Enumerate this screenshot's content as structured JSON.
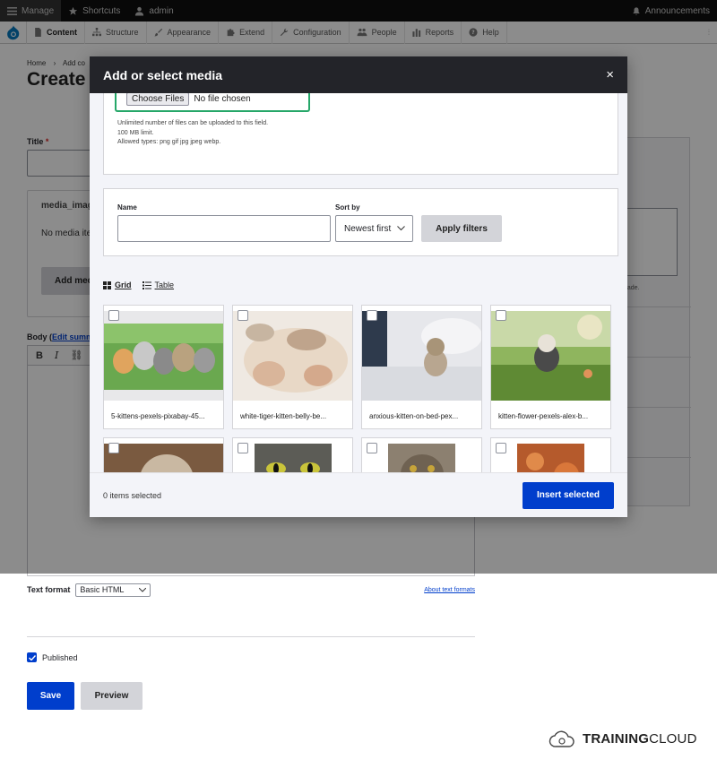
{
  "toolbar": {
    "manage": "Manage",
    "shortcuts": "Shortcuts",
    "user": "admin",
    "announcements": "Announcements"
  },
  "nav": {
    "items": [
      "Content",
      "Structure",
      "Appearance",
      "Extend",
      "Configuration",
      "People",
      "Reports",
      "Help"
    ]
  },
  "page": {
    "breadcrumb_home": "Home",
    "breadcrumb_sep": "›",
    "breadcrumb_next": "Add co",
    "title": "Create",
    "title_label": "Title",
    "title_required": "*",
    "media_label": "media_imag",
    "media_empty": "No media ite",
    "add_media": "Add med",
    "body_label": "Body (",
    "body_link": "Edit summ",
    "side_note": "nade.",
    "text_format_label": "Text format",
    "text_format_value": "Basic HTML",
    "about_formats": "About text formats",
    "published_label": "Published",
    "save": "Save",
    "preview": "Preview"
  },
  "brand": {
    "strong": "TRAINING",
    "rest": "CLOUD"
  },
  "modal": {
    "title": "Add or select media",
    "close": "×",
    "upload": {
      "choose_button": "Choose Files",
      "no_file": "No file chosen",
      "help_line1": "Unlimited number of files can be uploaded to this field.",
      "help_line2": "100 MB limit.",
      "help_line3": "Allowed types: png gif jpg jpeg webp."
    },
    "filters": {
      "name_label": "Name",
      "sort_label": "Sort by",
      "sort_value": "Newest first",
      "apply": "Apply filters"
    },
    "views": {
      "grid": "Grid",
      "table": "Table"
    },
    "media": [
      {
        "name": "5-kittens-pexels-pixabay-45..."
      },
      {
        "name": "white-tiger-kitten-belly-be..."
      },
      {
        "name": "anxious-kitten-on-bed-pex..."
      },
      {
        "name": "kitten-flower-pexels-alex-b..."
      },
      {
        "name": ""
      },
      {
        "name": ""
      },
      {
        "name": ""
      },
      {
        "name": ""
      }
    ],
    "footer": {
      "selected": "0 items selected",
      "insert": "Insert selected"
    }
  },
  "colors": {
    "primary": "#003ecc",
    "modal_header": "#232429",
    "focus": "#26a769"
  }
}
